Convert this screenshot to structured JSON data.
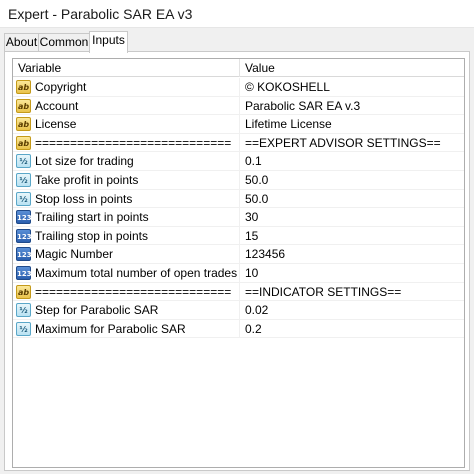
{
  "window": {
    "title": "Expert - Parabolic SAR EA v3"
  },
  "tabs": [
    {
      "label": "About",
      "active": false
    },
    {
      "label": "Common",
      "active": false
    },
    {
      "label": "Inputs",
      "active": true
    }
  ],
  "table": {
    "columns": {
      "variable": "Variable",
      "value": "Value"
    },
    "rows": [
      {
        "icon": "string-icon",
        "variable": "Copyright",
        "value": "© KOKOSHELL"
      },
      {
        "icon": "string-icon",
        "variable": "Account",
        "value": "Parabolic SAR EA v.3"
      },
      {
        "icon": "string-icon",
        "variable": "License",
        "value": "Lifetime License"
      },
      {
        "icon": "string-icon",
        "variable": "============================",
        "value": "==EXPERT ADVISOR SETTINGS=="
      },
      {
        "icon": "double-icon",
        "variable": "Lot size for trading",
        "value": "0.1"
      },
      {
        "icon": "double-icon",
        "variable": "Take profit in points",
        "value": "50.0"
      },
      {
        "icon": "double-icon",
        "variable": "Stop loss in points",
        "value": "50.0"
      },
      {
        "icon": "integer-icon",
        "variable": "Trailing start in points",
        "value": "30"
      },
      {
        "icon": "integer-icon",
        "variable": "Trailing stop in points",
        "value": "15"
      },
      {
        "icon": "integer-icon",
        "variable": "Magic Number",
        "value": "123456"
      },
      {
        "icon": "integer-icon",
        "variable": "Maximum total number of open trades",
        "value": "10"
      },
      {
        "icon": "string-icon",
        "variable": "============================",
        "value": "==INDICATOR SETTINGS=="
      },
      {
        "icon": "double-icon",
        "variable": "Step for Parabolic SAR",
        "value": "0.02"
      },
      {
        "icon": "double-icon",
        "variable": "Maximum for Parabolic SAR",
        "value": "0.2"
      }
    ]
  },
  "icons": {
    "string-icon": "ab",
    "double-icon": "½",
    "integer-icon": "123"
  }
}
